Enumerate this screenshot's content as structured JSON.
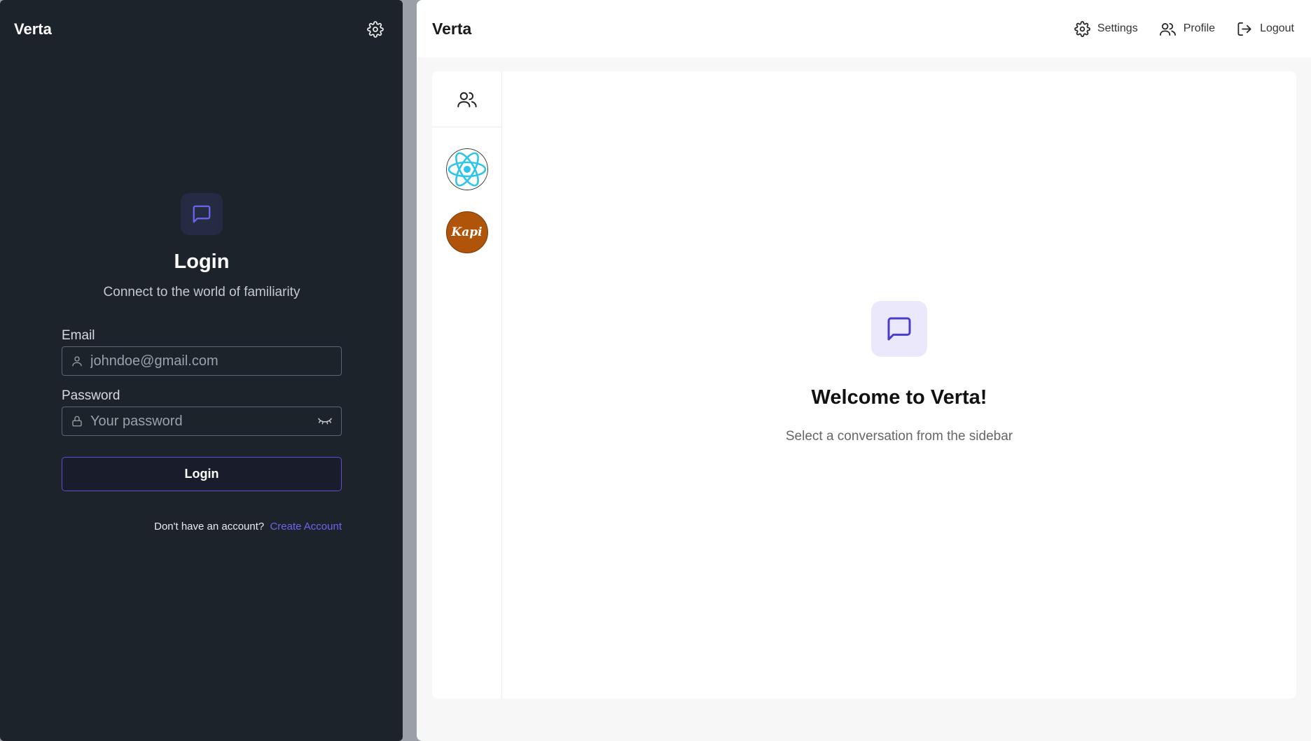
{
  "left": {
    "brand": "Verta",
    "login": {
      "title": "Login",
      "subtitle": "Connect to the world of familiarity",
      "email_label": "Email",
      "email_placeholder": "johndoe@gmail.com",
      "password_label": "Password",
      "password_placeholder": "Your password",
      "submit_label": "Login",
      "signup_prompt": "Don't have an account?",
      "signup_link": "Create Account"
    }
  },
  "right": {
    "brand": "Verta",
    "nav": {
      "settings": "Settings",
      "profile": "Profile",
      "logout": "Logout"
    },
    "sidebar": {
      "contacts": [
        {
          "name": "react-avatar"
        },
        {
          "name": "kapi-avatar",
          "text": "Kapi"
        }
      ]
    },
    "welcome": {
      "title": "Welcome to Verta!",
      "subtitle": "Select a conversation from the sidebar"
    }
  },
  "colors": {
    "accent": "#6d64f0",
    "dark_bg": "#1d232a",
    "light_bg": "#f7f7f7"
  },
  "icons": [
    "gear-icon",
    "message-square-icon",
    "user-icon",
    "lock-icon",
    "eye-closed-icon",
    "users-icon",
    "logout-icon"
  ]
}
